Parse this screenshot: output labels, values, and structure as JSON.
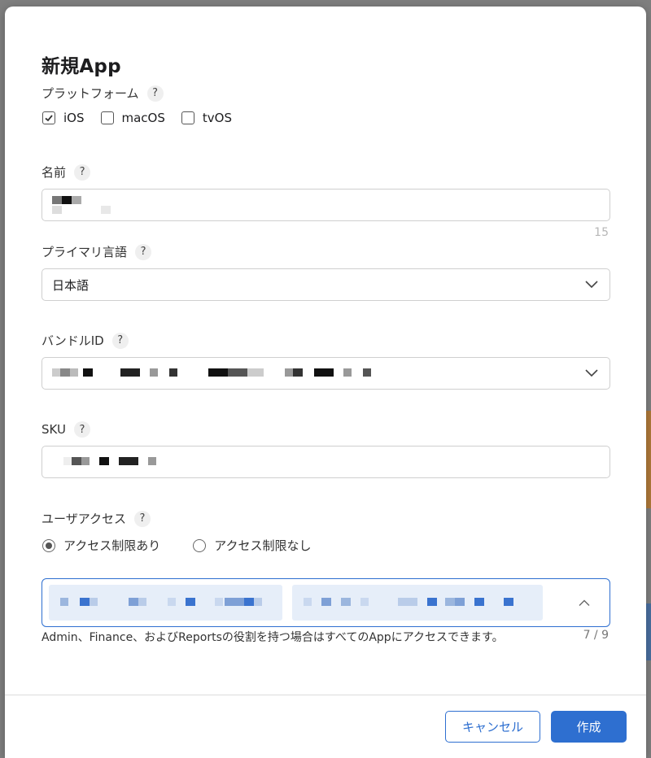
{
  "dialog": {
    "title": "新規App"
  },
  "platform": {
    "label": "プラットフォーム",
    "help": "?",
    "options": [
      {
        "label": "iOS",
        "checked": true
      },
      {
        "label": "macOS",
        "checked": false
      },
      {
        "label": "tvOS",
        "checked": false
      }
    ]
  },
  "name": {
    "label": "名前",
    "help": "?",
    "counter": "15"
  },
  "primary_language": {
    "label": "プライマリ言語",
    "help": "?",
    "value": "日本語"
  },
  "bundle_id": {
    "label": "バンドルID",
    "help": "?"
  },
  "sku": {
    "label": "SKU",
    "help": "?"
  },
  "user_access": {
    "label": "ユーザアクセス",
    "help": "?",
    "options": [
      {
        "label": "アクセス制限あり",
        "selected": true
      },
      {
        "label": "アクセス制限なし",
        "selected": false
      }
    ],
    "note": "Admin、Finance、およびReportsの役割を持つ場合はすべてのAppにアクセスできます。",
    "count": "7 / 9"
  },
  "buttons": {
    "cancel": "キャンセル",
    "create": "作成"
  },
  "colors": {
    "accent": "#2e6fd0",
    "chip_bg": "#e6eef9"
  }
}
